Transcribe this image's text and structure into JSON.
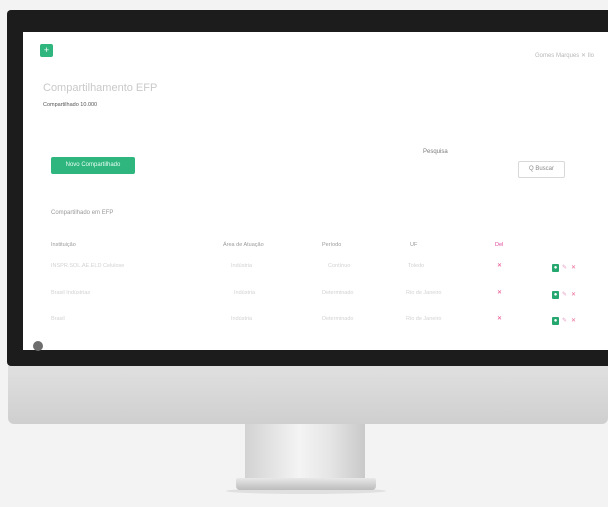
{
  "header": {
    "logo_icon": "+",
    "user_text": "Gomes Marques  ✕ Ilo"
  },
  "page": {
    "title": "Compartilhamento EFP",
    "subtitle": "Compartilhado 10.000"
  },
  "toolbar": {
    "new_label": "Novo Compartilhado"
  },
  "search": {
    "label": "Pesquisa",
    "placeholder": "",
    "button_label": "Q Buscar"
  },
  "table": {
    "section_label": "Compartilhado em EFP",
    "headers": [
      "Instituição",
      "Área de Atuação",
      "Período",
      "UF",
      "Del"
    ],
    "rows": [
      [
        "INSPR.SOL.AE.ELD Celulose",
        "Indústria",
        "Contínuo",
        "Toledo"
      ],
      [
        "Brasil Indústrias",
        "Indústria",
        "Determinado",
        "Rio de Janeiro"
      ],
      [
        "Brasil",
        "Indústria",
        "Determinado",
        "Rio de Janeiro"
      ]
    ],
    "delete_glyph": "✕",
    "actions": [
      "eye-icon",
      "edit-icon",
      "delete-icon"
    ]
  },
  "colors": {
    "brand": "#2fb57e",
    "danger": "#e94b8b"
  }
}
